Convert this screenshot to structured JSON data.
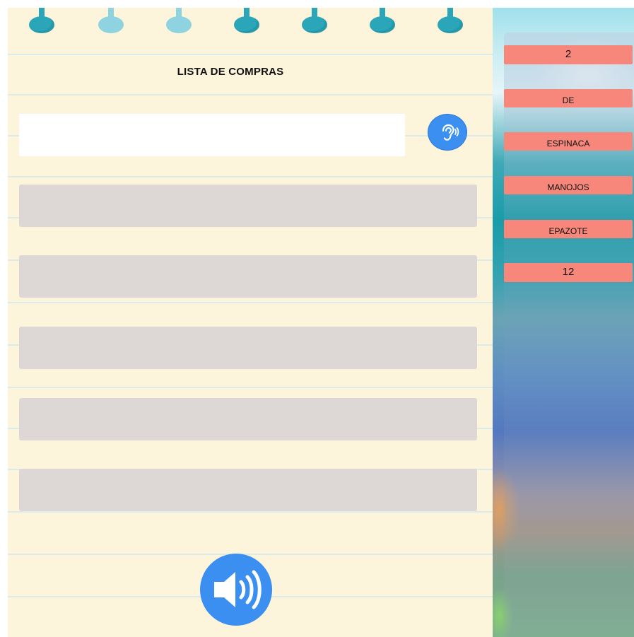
{
  "notebook": {
    "title": "LISTA DE COMPRAS",
    "input": {
      "value": "",
      "placeholder": ""
    },
    "list_slots": [
      "",
      "",
      "",
      "",
      ""
    ]
  },
  "icons": {
    "listen": "ear-sound-icon",
    "speaker": "speaker-volume-icon",
    "rings": "spiral-ring-icon"
  },
  "word_bank": {
    "chips": [
      "2",
      "DE",
      "ESPINACA",
      "MANOJOS",
      "EPAZOTE",
      "12"
    ]
  },
  "colors": {
    "paper": "#fcf5dc",
    "rule_line": "#d9ecea",
    "ring_dark": "#2aa6b8",
    "ring_light": "#8fd3e0",
    "button_blue": "#3b8ff0",
    "slot_gray": "#ddd8d6",
    "chip_salmon": "#f6877a"
  }
}
